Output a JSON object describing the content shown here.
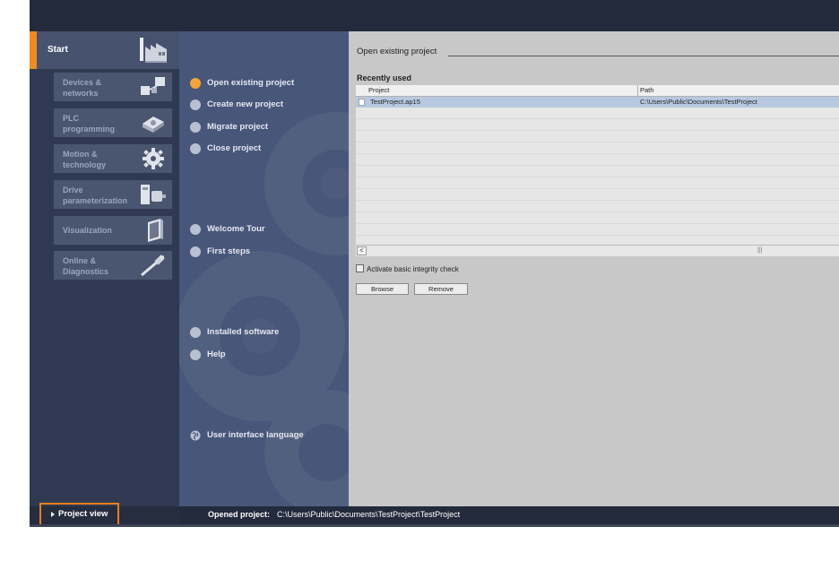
{
  "sidebar": {
    "start": "Start",
    "portals": [
      {
        "label": "Devices &\nnetworks",
        "icon": "devices-networks-icon"
      },
      {
        "label": "PLC\nprogramming",
        "icon": "plc-programming-icon"
      },
      {
        "label": "Motion &\ntechnology",
        "icon": "motion-gear-icon"
      },
      {
        "label": "Drive\nparameterization",
        "icon": "drive-motor-icon"
      },
      {
        "label": "Visualization",
        "icon": "visualization-panel-icon"
      },
      {
        "label": "Online &\nDiagnostics",
        "icon": "diagnostics-probe-icon"
      }
    ],
    "project_view": "Project view"
  },
  "menu": {
    "items": [
      {
        "label": "Open existing project",
        "active": true
      },
      {
        "label": "Create new project",
        "active": false
      },
      {
        "label": "Migrate project",
        "active": false
      },
      {
        "label": "Close project",
        "active": false
      },
      {
        "label": "Welcome Tour",
        "active": false
      },
      {
        "label": "First steps",
        "active": false
      },
      {
        "label": "Installed software",
        "active": false
      },
      {
        "label": "Help",
        "active": false
      },
      {
        "label": "User interface language",
        "active": false
      }
    ]
  },
  "content": {
    "title": "Open existing project",
    "recently_used": "Recently used",
    "columns": [
      "Project",
      "Path"
    ],
    "rows": [
      {
        "project": "TestProject.ap15",
        "path": "C:\\Users\\Public\\Documents\\TestProject"
      }
    ],
    "scroll_grip": "|||",
    "scroll_left": "<",
    "checkbox_label": "Activate basic integrity check",
    "browse": "Browse",
    "remove": "Remove"
  },
  "status": {
    "opened_label": "Opened project:",
    "opened_path": "C:\\Users\\Public\\Documents\\TestProject\\TestProject"
  },
  "colors": {
    "accent": "#f08a1c",
    "active_dot": "#f4a436",
    "sidebar_bg": "#2f3a52",
    "menu_bg": "#48567a",
    "content_bg": "#c8c8c8",
    "selected_row": "#b8c8e0"
  }
}
